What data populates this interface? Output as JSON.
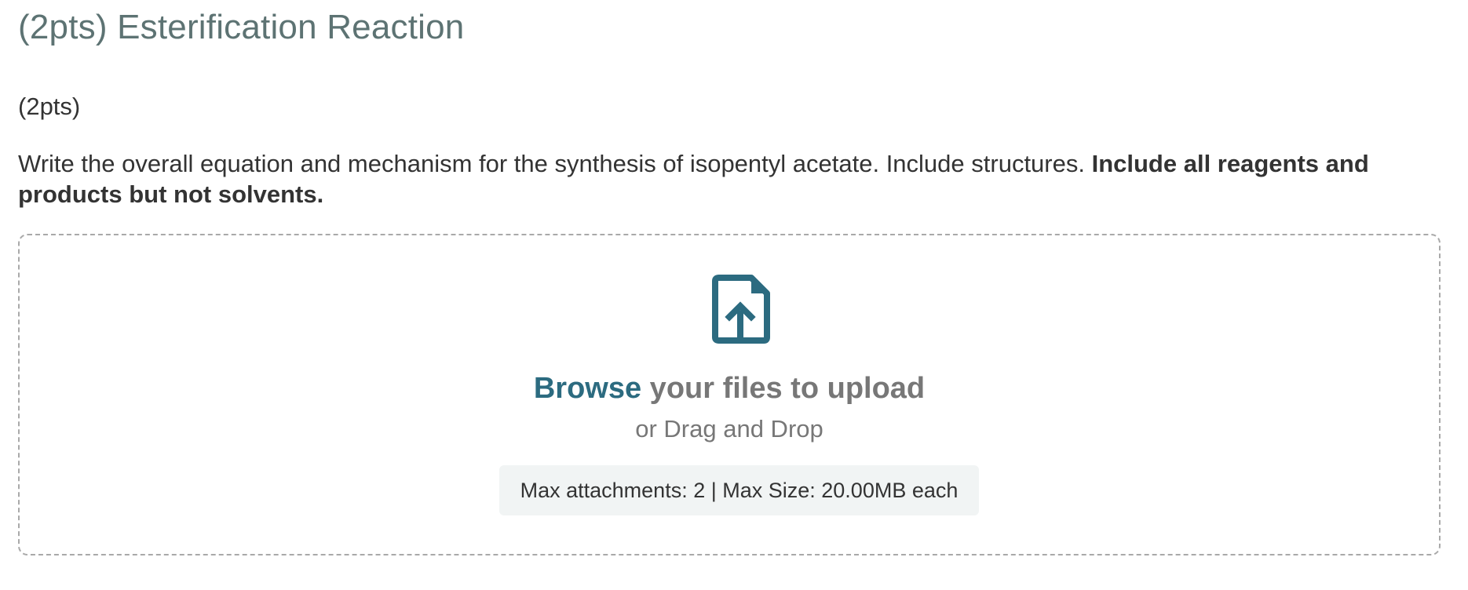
{
  "question": {
    "title": "(2pts) Esterification Reaction",
    "points_label": "(2pts)",
    "prompt_text": "Write the overall equation and mechanism for the synthesis of isopentyl acetate. Include structures. ",
    "prompt_bold": "Include all reagents and products but not solvents."
  },
  "upload": {
    "icon": "file-upload-icon",
    "browse_label": "Browse",
    "browse_suffix": " your files to upload",
    "drag_text": "or Drag and Drop",
    "limits_text": "Max attachments: 2 | Max Size: 20.00MB each"
  },
  "colors": {
    "title": "#5d7373",
    "accent": "#2c6b80",
    "muted_text": "#777777",
    "limits_bg": "#f1f4f4"
  }
}
